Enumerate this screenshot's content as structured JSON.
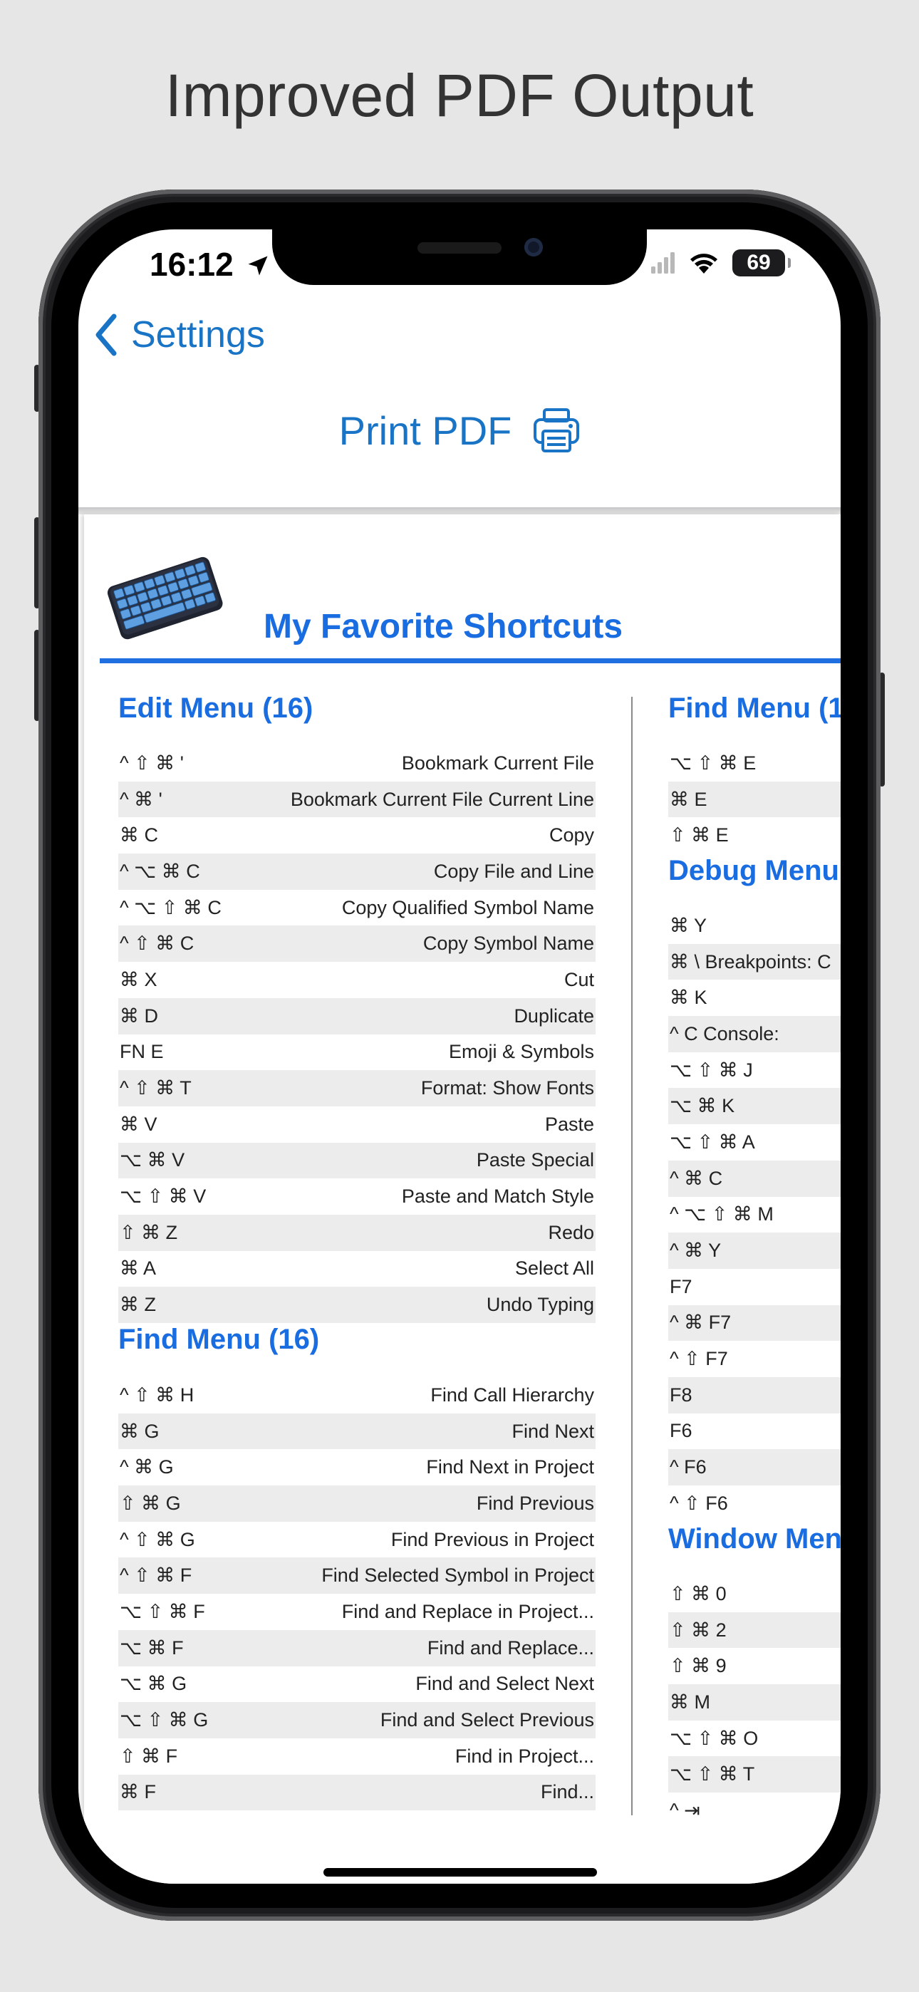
{
  "headline": "Improved PDF Output",
  "status": {
    "time": "16:12",
    "battery": "69"
  },
  "nav": {
    "back_label": "Settings"
  },
  "print": {
    "label": "Print PDF"
  },
  "pdf": {
    "title": "My Favorite Shortcuts",
    "edit_menu": {
      "title": "Edit Menu (16)",
      "rows": [
        {
          "k": "^ ⇧ ⌘ '",
          "d": "Bookmark Current File"
        },
        {
          "k": "^ ⌘ '",
          "d": "Bookmark Current File Current Line"
        },
        {
          "k": "⌘ C",
          "d": "Copy"
        },
        {
          "k": "^ ⌥ ⌘ C",
          "d": "Copy File and Line"
        },
        {
          "k": "^ ⌥ ⇧ ⌘ C",
          "d": "Copy Qualified Symbol Name"
        },
        {
          "k": "^ ⇧ ⌘ C",
          "d": "Copy Symbol Name"
        },
        {
          "k": "⌘ X",
          "d": "Cut"
        },
        {
          "k": "⌘ D",
          "d": "Duplicate"
        },
        {
          "k": "FN E",
          "d": "Emoji & Symbols"
        },
        {
          "k": "^ ⇧ ⌘ T",
          "d": "Format: Show Fonts"
        },
        {
          "k": "⌘ V",
          "d": "Paste"
        },
        {
          "k": "⌥ ⌘ V",
          "d": "Paste Special"
        },
        {
          "k": "⌥ ⇧ ⌘ V",
          "d": "Paste and Match Style"
        },
        {
          "k": "⇧ ⌘ Z",
          "d": "Redo"
        },
        {
          "k": "⌘ A",
          "d": "Select All"
        },
        {
          "k": "⌘ Z",
          "d": "Undo Typing"
        }
      ]
    },
    "find_menu": {
      "title": "Find Menu (16)",
      "rows": [
        {
          "k": "^ ⇧ ⌘ H",
          "d": "Find Call Hierarchy"
        },
        {
          "k": "⌘ G",
          "d": "Find Next"
        },
        {
          "k": "^ ⌘ G",
          "d": "Find Next in Project"
        },
        {
          "k": "⇧ ⌘ G",
          "d": "Find Previous"
        },
        {
          "k": "^ ⇧ ⌘ G",
          "d": "Find Previous in Project"
        },
        {
          "k": "^ ⇧ ⌘ F",
          "d": "Find Selected Symbol in Project"
        },
        {
          "k": "⌥ ⇧ ⌘ F",
          "d": "Find and Replace in Project..."
        },
        {
          "k": "⌥ ⌘ F",
          "d": "Find and Replace..."
        },
        {
          "k": "⌥ ⌘ G",
          "d": "Find and Select Next"
        },
        {
          "k": "⌥ ⇧ ⌘ G",
          "d": "Find and Select Previous"
        },
        {
          "k": "⇧ ⌘ F",
          "d": "Find in Project..."
        },
        {
          "k": "⌘ F",
          "d": "Find..."
        }
      ]
    },
    "col2_find": {
      "title": "Find Menu (1",
      "rows": [
        {
          "k": "⌥ ⇧ ⌘ E"
        },
        {
          "k": "⌘ E"
        },
        {
          "k": "⇧ ⌘ E"
        }
      ]
    },
    "col2_debug": {
      "title": "Debug Menu",
      "rows": [
        {
          "k": "⌘ Y"
        },
        {
          "k": "⌘ \\ Breakpoints: C"
        },
        {
          "k": "⌘ K"
        },
        {
          "k": "^ C      Console:"
        },
        {
          "k": "⌥ ⇧ ⌘ J"
        },
        {
          "k": "⌥ ⌘ K"
        },
        {
          "k": "⌥ ⇧ ⌘ A"
        },
        {
          "k": "^ ⌘ C"
        },
        {
          "k": "^ ⌥ ⇧ ⌘ M"
        },
        {
          "k": "^ ⌘ Y"
        },
        {
          "k": "F7"
        },
        {
          "k": "^ ⌘ F7"
        },
        {
          "k": "^ ⇧ F7"
        },
        {
          "k": "F8"
        },
        {
          "k": "F6"
        },
        {
          "k": "^ F6"
        },
        {
          "k": "^ ⇧ F6"
        }
      ]
    },
    "col2_window": {
      "title": "Window Men",
      "rows": [
        {
          "k": "⇧ ⌘ 0"
        },
        {
          "k": "⇧ ⌘ 2"
        },
        {
          "k": "⇧ ⌘ 9"
        },
        {
          "k": "⌘ M"
        },
        {
          "k": "⌥ ⇧ ⌘ O"
        },
        {
          "k": "⌥ ⇧ ⌘ T"
        },
        {
          "k": "^ ⇥"
        }
      ]
    }
  }
}
